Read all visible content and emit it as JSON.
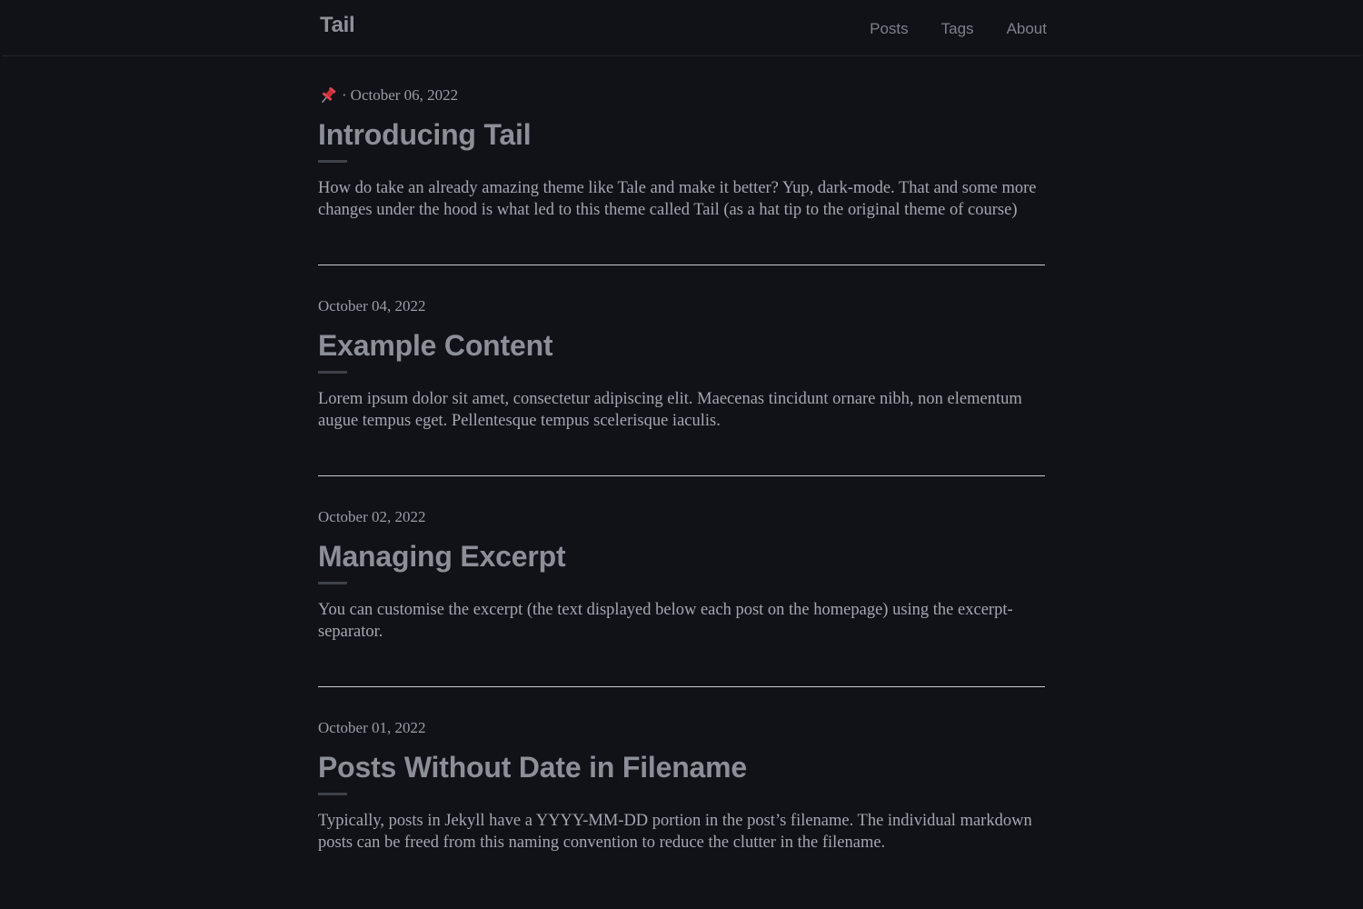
{
  "header": {
    "site_title": "Tail",
    "nav": [
      "Posts",
      "Tags",
      "About"
    ]
  },
  "posts": [
    {
      "pinned": true,
      "pin_icon": "pushpin-icon",
      "separator": "·",
      "date": "October 06, 2022",
      "title": "Introducing Tail",
      "excerpt": "How do take an already amazing theme like Tale and make it better? Yup, dark-mode. That and some more changes under the hood is what led to this theme called Tail (as a hat tip to the original theme of course)"
    },
    {
      "pinned": false,
      "date": "October 04, 2022",
      "title": "Example Content",
      "excerpt": "Lorem ipsum dolor sit amet, consectetur adipiscing elit. Maecenas tincidunt ornare nibh, non elementum augue tempus eget. Pellentesque tempus scelerisque iaculis."
    },
    {
      "pinned": false,
      "date": "October 02, 2022",
      "title": "Managing Excerpt",
      "excerpt": "You can customise the excerpt (the text displayed below each post on the homepage) using the excerpt-separator."
    },
    {
      "pinned": false,
      "date": "October 01, 2022",
      "title": "Posts Without Date in Filename",
      "excerpt": "Typically, posts in Jekyll have a YYYY-MM-DD portion in the post’s filename. The individual markdown posts can be freed from this naming convention to reduce the clutter in the filename."
    }
  ],
  "colors": {
    "background": "#101218",
    "title": "#8c8f98",
    "text": "#a4a7af",
    "pin": "#d0323c"
  }
}
